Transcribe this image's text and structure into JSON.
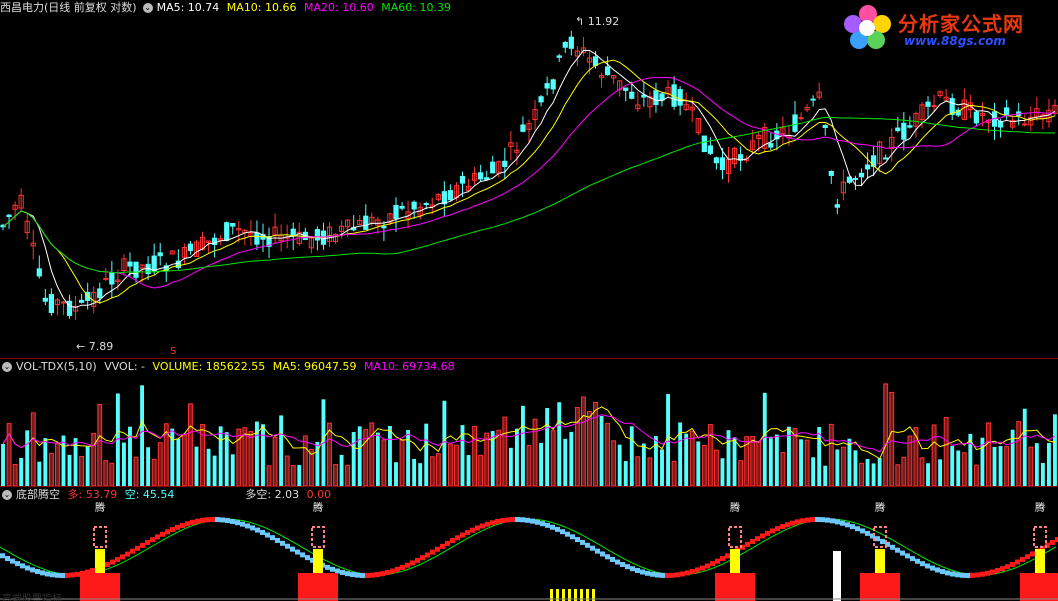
{
  "price_panel": {
    "title": "西昌电力(日线 前复权 对数)",
    "ma5": "MA5: 10.74",
    "ma10": "MA10: 10.66",
    "ma20": "MA20: 10.60",
    "ma60": "MA60: 10.39",
    "high_label": "11.92",
    "low_label": "7.89",
    "signal_mark": "S",
    "colors": {
      "up": "#ff3232",
      "down": "#54ffff",
      "ma5": "#ffffff",
      "ma10": "#ffff00",
      "ma20": "#ff00ff",
      "ma60": "#00e600"
    }
  },
  "volume_panel": {
    "title": "VOL-TDX(5,10)",
    "vvol": "VVOL: -",
    "volume": "VOLUME: 185622.55",
    "ma5": "MA5: 96047.59",
    "ma10": "MA10: 69734.68"
  },
  "indicator_panel": {
    "title": "底部腾空",
    "duo": "多: 53.79",
    "kong": "空: 45.54",
    "duokong": "多空: 2.03",
    "zero": "0.00",
    "teng_label": "腾",
    "watermark": "高端股票指标"
  },
  "logo": {
    "name": "分析家公式网",
    "url": "www.88gs.com",
    "icon": "flower-logo-icon"
  }
}
